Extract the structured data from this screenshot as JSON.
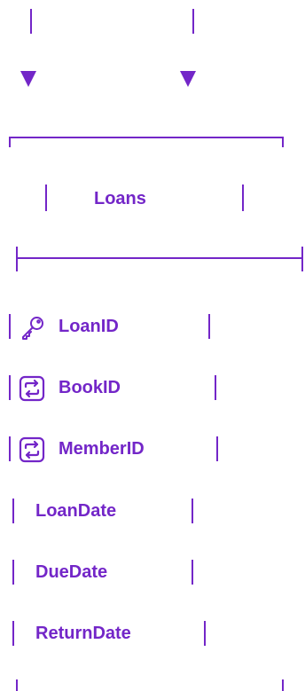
{
  "entity": {
    "name": "Loans",
    "fields": [
      {
        "name": "LoanID",
        "icon": "key-icon"
      },
      {
        "name": "BookID",
        "icon": "relation-icon"
      },
      {
        "name": "MemberID",
        "icon": "relation-icon"
      },
      {
        "name": "LoanDate",
        "icon": ""
      },
      {
        "name": "DueDate",
        "icon": ""
      },
      {
        "name": "ReturnDate",
        "icon": ""
      }
    ]
  },
  "colors": {
    "accent": "#7326c8"
  }
}
